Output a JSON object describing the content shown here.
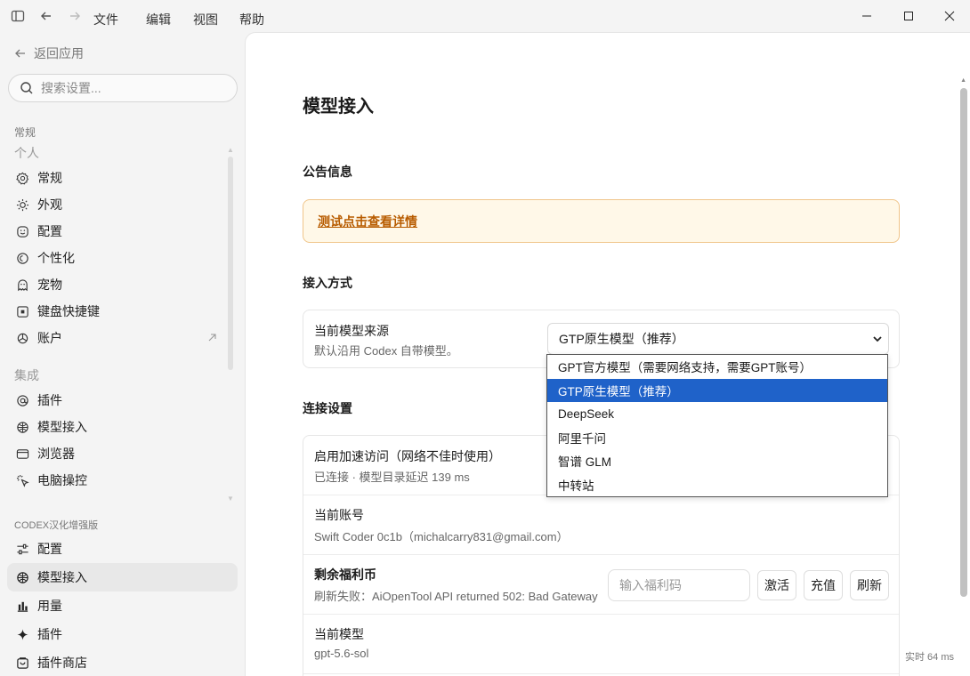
{
  "menu": [
    "文件",
    "编辑",
    "视图",
    "帮助"
  ],
  "sidebar": {
    "back_label": "返回应用",
    "search_placeholder": "搜索设置...",
    "group_general": "常规",
    "sub_personal": "个人",
    "personal_items": [
      "常规",
      "外观",
      "配置",
      "个性化",
      "宠物",
      "键盘快捷键",
      "账户"
    ],
    "group_integration": "集成",
    "integration_items": [
      "插件",
      "模型接入",
      "浏览器",
      "电脑操控"
    ],
    "group_codex": "CODEX汉化增强版",
    "codex_items": [
      "配置",
      "模型接入",
      "用量",
      "插件",
      "插件商店"
    ]
  },
  "main": {
    "title": "模型接入",
    "notice_title": "公告信息",
    "notice_link": "测试点击查看详情",
    "access_title": "接入方式",
    "source_label": "当前模型来源",
    "source_sub": "默认沿用 Codex 自带模型。",
    "source_selected": "GTP原生模型（推荐）",
    "source_options": [
      "GPT官方模型（需要网络支持，需要GPT账号）",
      "GTP原生模型（推荐）",
      "DeepSeek",
      "阿里千问",
      "智谱 GLM",
      "中转站"
    ],
    "connection_title": "连接设置",
    "accel_label": "启用加速访问（网络不佳时使用）",
    "accel_status": "已连接 · 模型目录延迟 139 ms",
    "account_label": "当前账号",
    "account_value": "Swift Coder 0c1b（michalcarry831@gmail.com）",
    "coins_label": "剩余福利币",
    "coins_error": "刷新失败：AiOpenTool API returned 502: Bad Gateway",
    "code_placeholder": "输入福利码",
    "btn_activate": "激活",
    "btn_recharge": "充值",
    "btn_refresh": "刷新",
    "model_label": "当前模型",
    "model_value": "gpt-5.6-sol",
    "latency": "实时 64 ms"
  },
  "colors": {
    "accent": "#1f62c9",
    "notice_bg": "#fff8e8",
    "notice_link": "#b85c00"
  }
}
